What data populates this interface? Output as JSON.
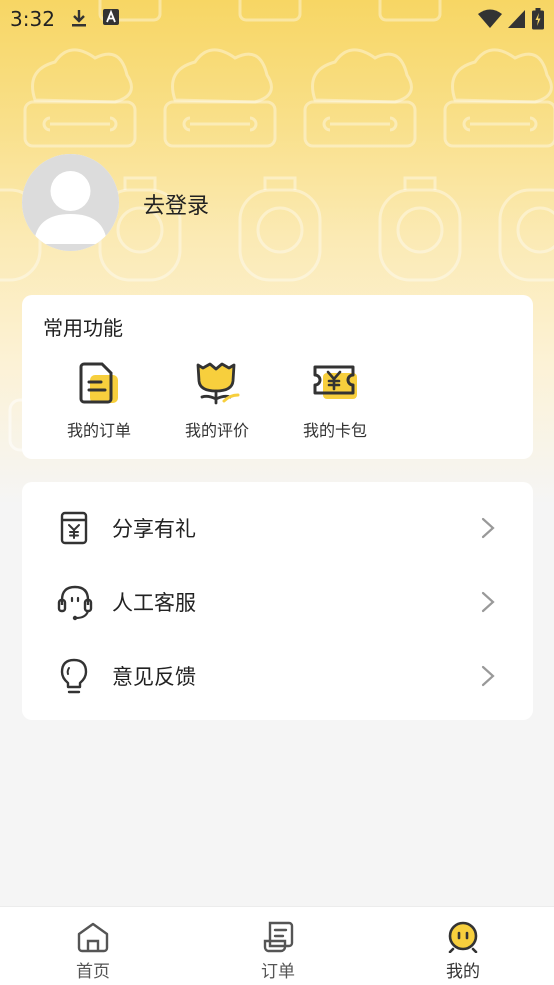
{
  "status_bar": {
    "time": "3:32",
    "left_icons": [
      "download-icon",
      "text-a-icon"
    ],
    "right_icons": [
      "wifi-icon",
      "signal-icon",
      "battery-icon"
    ]
  },
  "profile": {
    "login_text": "去登录"
  },
  "common_functions": {
    "title": "常用功能",
    "items": [
      {
        "label": "我的订单",
        "icon": "order-document-icon"
      },
      {
        "label": "我的评价",
        "icon": "flower-review-icon"
      },
      {
        "label": "我的卡包",
        "icon": "coupon-ticket-icon"
      }
    ]
  },
  "menu": {
    "items": [
      {
        "label": "分享有礼",
        "icon": "gift-share-icon"
      },
      {
        "label": "人工客服",
        "icon": "headset-icon"
      },
      {
        "label": "意见反馈",
        "icon": "lightbulb-icon"
      }
    ]
  },
  "tabbar": {
    "tabs": [
      {
        "label": "首页",
        "icon": "home-icon"
      },
      {
        "label": "订单",
        "icon": "order-list-icon"
      },
      {
        "label": "我的",
        "icon": "mine-face-icon"
      }
    ],
    "active_index": 2
  },
  "colors": {
    "accent_yellow": "#f7cf3d",
    "hero_top": "#f7d664",
    "background": "#f5f5f5",
    "icon_dark": "#333333"
  }
}
